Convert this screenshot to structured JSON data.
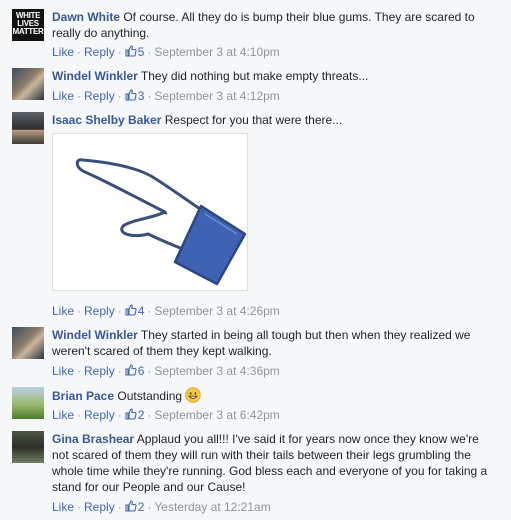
{
  "comments": [
    {
      "author": "Dawn White",
      "text": "Of course. All they do is bump their blue gums. They are scared to really do anything.",
      "avatar_lines": [
        "WHITE",
        "LIVES",
        "MATTER"
      ],
      "like_label": "Like",
      "reply_label": "Reply",
      "likes": "5",
      "timestamp": "September 3 at 4:10pm"
    },
    {
      "author": "Windel Winkler",
      "text": "They did nothing but make empty threats...",
      "like_label": "Like",
      "reply_label": "Reply",
      "likes": "3",
      "timestamp": "September 3 at 4:12pm"
    },
    {
      "author": "Isaac Shelby Baker",
      "text": "Respect for you that were there...",
      "attachment_icon": "thumbs-up-sketch",
      "like_label": "Like",
      "reply_label": "Reply",
      "likes": "4",
      "timestamp": "September 3 at 4:26pm"
    },
    {
      "author": "Windel Winkler",
      "text": "They started in being all tough but then when they realized we weren't scared of them they kept walking.",
      "like_label": "Like",
      "reply_label": "Reply",
      "likes": "6",
      "timestamp": "September 3 at 4:36pm"
    },
    {
      "author": "Brian Pace",
      "text": "Outstanding",
      "emoji": "smiley-icon",
      "like_label": "Like",
      "reply_label": "Reply",
      "likes": "2",
      "timestamp": "September 3 at 6:42pm"
    },
    {
      "author": "Gina Brashear",
      "text": "Applaud you all!!! I've said it for years now once they know we're not scared of them they will run with their tails between their legs grumbling the whole time while they're running. God bless each and everyone of you for taking a stand for our People and our Cause!",
      "like_label": "Like",
      "reply_label": "Reply",
      "likes": "2",
      "timestamp": "Yesterday at 12:21am"
    }
  ],
  "colors": {
    "name": "#365899",
    "link": "#4267b2",
    "meta": "#90949c",
    "background": "#f6f7f9"
  }
}
